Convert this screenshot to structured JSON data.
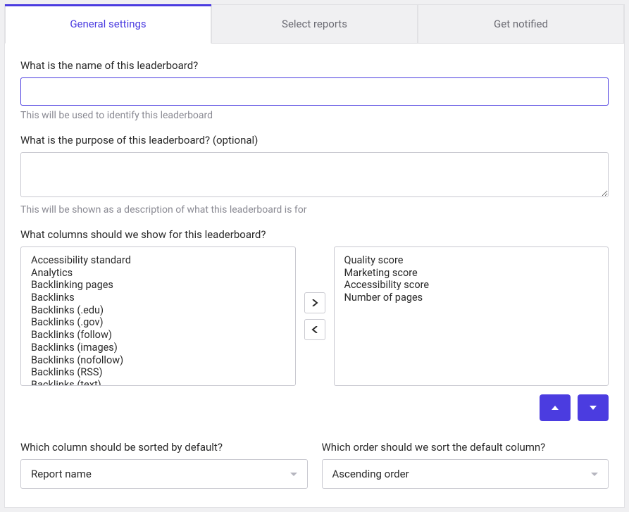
{
  "tabs": [
    {
      "label": "General settings",
      "active": true
    },
    {
      "label": "Select reports",
      "active": false
    },
    {
      "label": "Get notified",
      "active": false
    }
  ],
  "name_field": {
    "label": "What is the name of this leaderboard?",
    "value": "",
    "helper": "This will be used to identify this leaderboard"
  },
  "purpose_field": {
    "label": "What is the purpose of this leaderboard? (optional)",
    "value": "",
    "helper": "This will be shown as a description of what this leaderboard is for"
  },
  "columns_section": {
    "label": "What columns should we show for this leaderboard?",
    "available": [
      "Accessibility standard",
      "Analytics",
      "Backlinking pages",
      "Backlinks",
      "Backlinks (.edu)",
      "Backlinks (.gov)",
      "Backlinks (follow)",
      "Backlinks (images)",
      "Backlinks (nofollow)",
      "Backlinks (RSS)",
      "Backlinks (text)"
    ],
    "selected": [
      "Quality score",
      "Marketing score",
      "Accessibility score",
      "Number of pages"
    ]
  },
  "sort_column": {
    "label": "Which column should be sorted by default?",
    "value": "Report name"
  },
  "sort_order": {
    "label": "Which order should we sort the default column?",
    "value": "Ascending order"
  }
}
